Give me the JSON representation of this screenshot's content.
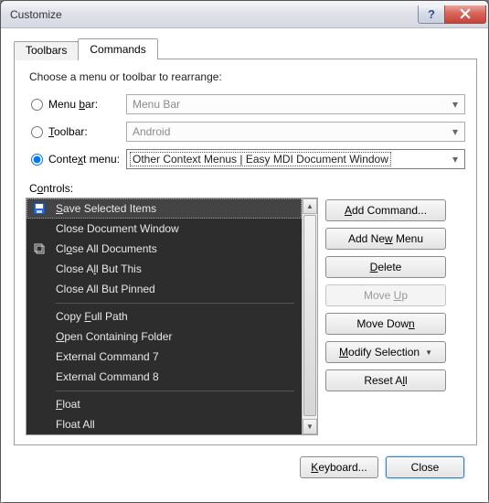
{
  "window": {
    "title": "Customize"
  },
  "tabs": {
    "toolbars": "Toolbars",
    "commands": "Commands"
  },
  "panel": {
    "instruction": "Choose a menu or toolbar to rearrange:",
    "menu_bar_label": "Menu bar:",
    "menu_bar_value": "Menu Bar",
    "toolbar_label": "Toolbar:",
    "toolbar_value": "Android",
    "context_label": "Context menu:",
    "context_value": "Other Context Menus | Easy MDI Document Window",
    "controls_label": "Controls:"
  },
  "items": [
    {
      "label": "Save Selected Items",
      "u": 0,
      "icon": "save",
      "selected": true
    },
    {
      "label": "Close Document Window",
      "u": -1
    },
    {
      "label": "Close All Documents",
      "u": 2,
      "icon": "closeall"
    },
    {
      "label": "Close All But This",
      "u": 7
    },
    {
      "label": "Close All But Pinned",
      "u": -1
    },
    {
      "sep": true
    },
    {
      "label": "Copy Full Path",
      "u": 5
    },
    {
      "label": "Open Containing Folder",
      "u": 0
    },
    {
      "label": "External Command 7",
      "u": -1
    },
    {
      "label": "External Command 8",
      "u": -1
    },
    {
      "sep": true
    },
    {
      "label": "Float",
      "u": 0
    },
    {
      "label": "Float All",
      "u": -1
    }
  ],
  "side": {
    "add_command": "Add Command...",
    "add_new_menu": "Add New Menu",
    "delete": "Delete",
    "move_up": "Move Up",
    "move_down": "Move Down",
    "modify_selection": "Modify Selection",
    "reset_all": "Reset All"
  },
  "footer": {
    "keyboard": "Keyboard...",
    "close": "Close"
  }
}
